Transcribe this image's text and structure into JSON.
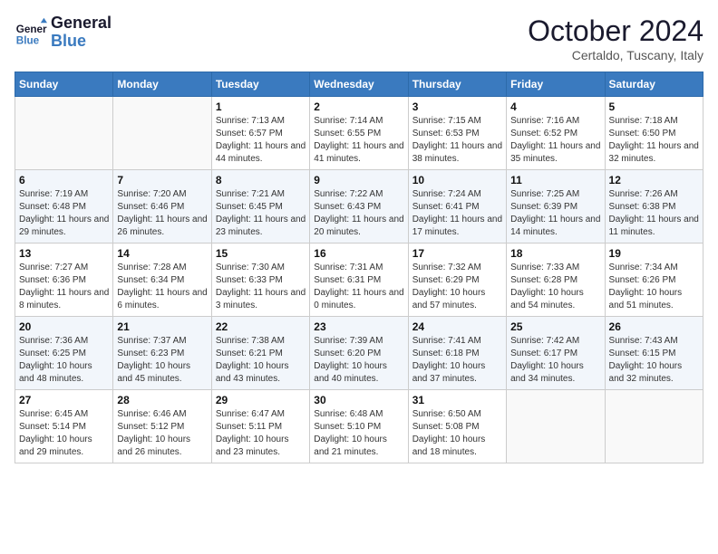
{
  "header": {
    "logo_line1": "General",
    "logo_line2": "Blue",
    "month": "October 2024",
    "location": "Certaldo, Tuscany, Italy"
  },
  "weekdays": [
    "Sunday",
    "Monday",
    "Tuesday",
    "Wednesday",
    "Thursday",
    "Friday",
    "Saturday"
  ],
  "weeks": [
    [
      {
        "day": "",
        "detail": ""
      },
      {
        "day": "",
        "detail": ""
      },
      {
        "day": "1",
        "detail": "Sunrise: 7:13 AM\nSunset: 6:57 PM\nDaylight: 11 hours and 44 minutes."
      },
      {
        "day": "2",
        "detail": "Sunrise: 7:14 AM\nSunset: 6:55 PM\nDaylight: 11 hours and 41 minutes."
      },
      {
        "day": "3",
        "detail": "Sunrise: 7:15 AM\nSunset: 6:53 PM\nDaylight: 11 hours and 38 minutes."
      },
      {
        "day": "4",
        "detail": "Sunrise: 7:16 AM\nSunset: 6:52 PM\nDaylight: 11 hours and 35 minutes."
      },
      {
        "day": "5",
        "detail": "Sunrise: 7:18 AM\nSunset: 6:50 PM\nDaylight: 11 hours and 32 minutes."
      }
    ],
    [
      {
        "day": "6",
        "detail": "Sunrise: 7:19 AM\nSunset: 6:48 PM\nDaylight: 11 hours and 29 minutes."
      },
      {
        "day": "7",
        "detail": "Sunrise: 7:20 AM\nSunset: 6:46 PM\nDaylight: 11 hours and 26 minutes."
      },
      {
        "day": "8",
        "detail": "Sunrise: 7:21 AM\nSunset: 6:45 PM\nDaylight: 11 hours and 23 minutes."
      },
      {
        "day": "9",
        "detail": "Sunrise: 7:22 AM\nSunset: 6:43 PM\nDaylight: 11 hours and 20 minutes."
      },
      {
        "day": "10",
        "detail": "Sunrise: 7:24 AM\nSunset: 6:41 PM\nDaylight: 11 hours and 17 minutes."
      },
      {
        "day": "11",
        "detail": "Sunrise: 7:25 AM\nSunset: 6:39 PM\nDaylight: 11 hours and 14 minutes."
      },
      {
        "day": "12",
        "detail": "Sunrise: 7:26 AM\nSunset: 6:38 PM\nDaylight: 11 hours and 11 minutes."
      }
    ],
    [
      {
        "day": "13",
        "detail": "Sunrise: 7:27 AM\nSunset: 6:36 PM\nDaylight: 11 hours and 8 minutes."
      },
      {
        "day": "14",
        "detail": "Sunrise: 7:28 AM\nSunset: 6:34 PM\nDaylight: 11 hours and 6 minutes."
      },
      {
        "day": "15",
        "detail": "Sunrise: 7:30 AM\nSunset: 6:33 PM\nDaylight: 11 hours and 3 minutes."
      },
      {
        "day": "16",
        "detail": "Sunrise: 7:31 AM\nSunset: 6:31 PM\nDaylight: 11 hours and 0 minutes."
      },
      {
        "day": "17",
        "detail": "Sunrise: 7:32 AM\nSunset: 6:29 PM\nDaylight: 10 hours and 57 minutes."
      },
      {
        "day": "18",
        "detail": "Sunrise: 7:33 AM\nSunset: 6:28 PM\nDaylight: 10 hours and 54 minutes."
      },
      {
        "day": "19",
        "detail": "Sunrise: 7:34 AM\nSunset: 6:26 PM\nDaylight: 10 hours and 51 minutes."
      }
    ],
    [
      {
        "day": "20",
        "detail": "Sunrise: 7:36 AM\nSunset: 6:25 PM\nDaylight: 10 hours and 48 minutes."
      },
      {
        "day": "21",
        "detail": "Sunrise: 7:37 AM\nSunset: 6:23 PM\nDaylight: 10 hours and 45 minutes."
      },
      {
        "day": "22",
        "detail": "Sunrise: 7:38 AM\nSunset: 6:21 PM\nDaylight: 10 hours and 43 minutes."
      },
      {
        "day": "23",
        "detail": "Sunrise: 7:39 AM\nSunset: 6:20 PM\nDaylight: 10 hours and 40 minutes."
      },
      {
        "day": "24",
        "detail": "Sunrise: 7:41 AM\nSunset: 6:18 PM\nDaylight: 10 hours and 37 minutes."
      },
      {
        "day": "25",
        "detail": "Sunrise: 7:42 AM\nSunset: 6:17 PM\nDaylight: 10 hours and 34 minutes."
      },
      {
        "day": "26",
        "detail": "Sunrise: 7:43 AM\nSunset: 6:15 PM\nDaylight: 10 hours and 32 minutes."
      }
    ],
    [
      {
        "day": "27",
        "detail": "Sunrise: 6:45 AM\nSunset: 5:14 PM\nDaylight: 10 hours and 29 minutes."
      },
      {
        "day": "28",
        "detail": "Sunrise: 6:46 AM\nSunset: 5:12 PM\nDaylight: 10 hours and 26 minutes."
      },
      {
        "day": "29",
        "detail": "Sunrise: 6:47 AM\nSunset: 5:11 PM\nDaylight: 10 hours and 23 minutes."
      },
      {
        "day": "30",
        "detail": "Sunrise: 6:48 AM\nSunset: 5:10 PM\nDaylight: 10 hours and 21 minutes."
      },
      {
        "day": "31",
        "detail": "Sunrise: 6:50 AM\nSunset: 5:08 PM\nDaylight: 10 hours and 18 minutes."
      },
      {
        "day": "",
        "detail": ""
      },
      {
        "day": "",
        "detail": ""
      }
    ]
  ]
}
